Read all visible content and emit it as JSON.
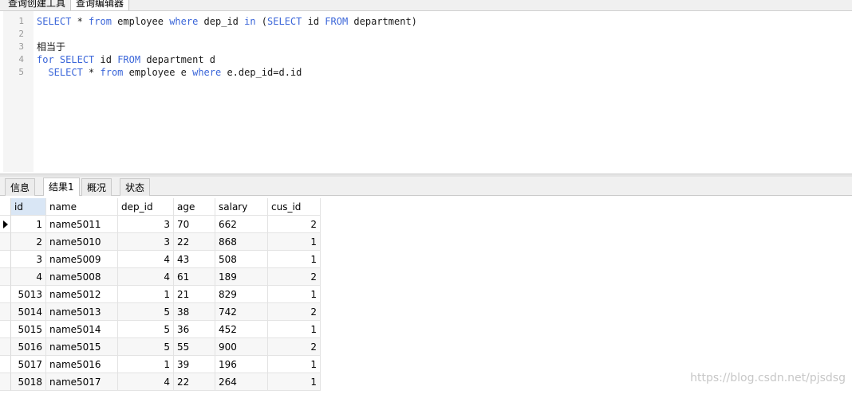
{
  "top_tabs": [
    "查询创建工具",
    "查询编辑器"
  ],
  "editor": {
    "lines": [
      {
        "n": "1",
        "tokens": [
          [
            "kw",
            "SELECT"
          ],
          [
            "tx",
            " * "
          ],
          [
            "kw",
            "from"
          ],
          [
            "tx",
            " employee "
          ],
          [
            "kw",
            "where"
          ],
          [
            "tx",
            " dep_id "
          ],
          [
            "kw",
            "in"
          ],
          [
            "tx",
            " ("
          ],
          [
            "kw",
            "SELECT"
          ],
          [
            "tx",
            " id "
          ],
          [
            "kw",
            "FROM"
          ],
          [
            "tx",
            " department)"
          ]
        ]
      },
      {
        "n": "2",
        "tokens": []
      },
      {
        "n": "3",
        "tokens": [
          [
            "tx",
            "相当于"
          ]
        ]
      },
      {
        "n": "4",
        "tokens": [
          [
            "kw",
            "for"
          ],
          [
            "tx",
            " "
          ],
          [
            "kw",
            "SELECT"
          ],
          [
            "tx",
            " id "
          ],
          [
            "kw",
            "FROM"
          ],
          [
            "tx",
            " department d"
          ]
        ]
      },
      {
        "n": "5",
        "tokens": [
          [
            "tx",
            "  "
          ],
          [
            "kw",
            "SELECT"
          ],
          [
            "tx",
            " * "
          ],
          [
            "kw",
            "from"
          ],
          [
            "tx",
            " employee e "
          ],
          [
            "kw",
            "where"
          ],
          [
            "tx",
            " e.dep_id=d.id"
          ]
        ]
      }
    ]
  },
  "result_tabs": [
    "信息",
    "结果1",
    "概况",
    "状态"
  ],
  "active_result_tab": "结果1",
  "grid": {
    "columns": [
      "id",
      "name",
      "dep_id",
      "age",
      "salary",
      "cus_id"
    ],
    "rows": [
      [
        "1",
        "name5011",
        "3",
        "70",
        "662",
        "2"
      ],
      [
        "2",
        "name5010",
        "3",
        "22",
        "868",
        "1"
      ],
      [
        "3",
        "name5009",
        "4",
        "43",
        "508",
        "1"
      ],
      [
        "4",
        "name5008",
        "4",
        "61",
        "189",
        "2"
      ],
      [
        "5013",
        "name5012",
        "1",
        "21",
        "829",
        "1"
      ],
      [
        "5014",
        "name5013",
        "5",
        "38",
        "742",
        "2"
      ],
      [
        "5015",
        "name5014",
        "5",
        "36",
        "452",
        "1"
      ],
      [
        "5016",
        "name5015",
        "5",
        "55",
        "900",
        "2"
      ],
      [
        "5017",
        "name5016",
        "1",
        "39",
        "196",
        "1"
      ],
      [
        "5018",
        "name5017",
        "4",
        "22",
        "264",
        "1"
      ]
    ]
  },
  "watermark": "https://blog.csdn.net/pjsdsg",
  "colors": {
    "keyword": "#3b66d9",
    "selected_header": "#d9e6f5"
  }
}
